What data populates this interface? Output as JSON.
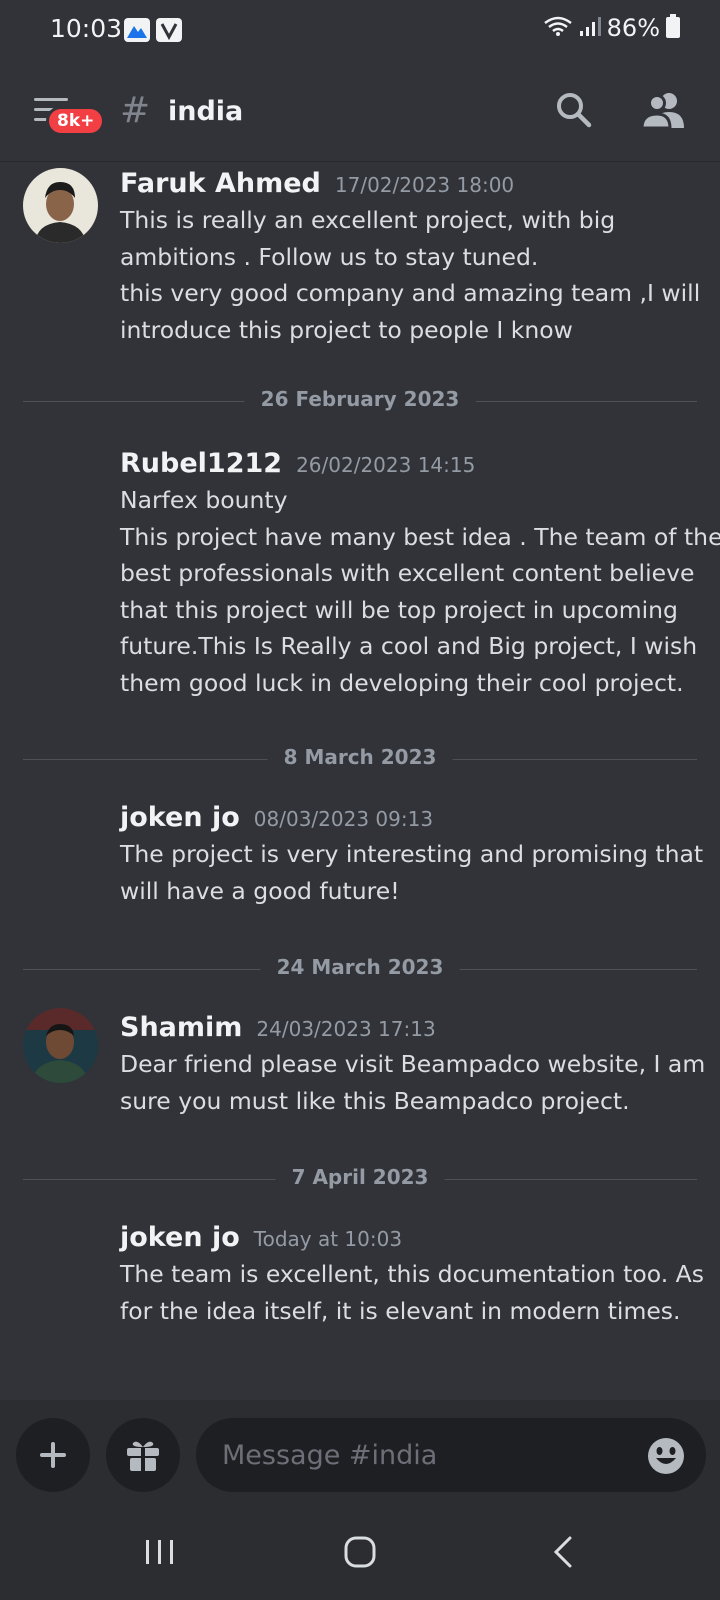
{
  "status_bar": {
    "time": "10:03",
    "battery": "86%",
    "icons": [
      "notification-app-icon",
      "notification-app-icon",
      "wifi-icon",
      "signal-icon",
      "battery-icon"
    ]
  },
  "header": {
    "badge": "8k+",
    "channel": "india",
    "hash": "#"
  },
  "messages": [
    {
      "author": "Faruk Ahmed",
      "timestamp": "17/02/2023 18:00",
      "lines": [
        "This is really an excellent project, with big",
        "ambitions . Follow us to stay tuned.",
        "this very good company and amazing team ,I will",
        "introduce this project to people I know"
      ]
    },
    {
      "author": "Rubel1212",
      "timestamp": "26/02/2023 14:15",
      "lines": [
        "Narfex bounty",
        "This project have many best idea . The team of the",
        "best professionals with excellent content believe",
        "that this project will be top project in upcoming",
        "future.This Is Really a cool and Big project, I wish",
        "them good luck in developing their cool project."
      ]
    },
    {
      "author": "joken  jo",
      "timestamp": "08/03/2023 09:13",
      "lines": [
        "The project is very interesting and promising that",
        "will have a good future!"
      ]
    },
    {
      "author": "Shamim",
      "timestamp": "24/03/2023 17:13",
      "lines": [
        "Dear friend please visit Beampadco  website, I am",
        "sure you must like this Beampadco  project."
      ]
    },
    {
      "author": "joken  jo",
      "timestamp": "Today at 10:03",
      "lines": [
        "The team is excellent, this documentation too. As",
        "for the idea itself, it is elevant in modern times."
      ]
    }
  ],
  "dividers": [
    "26 February 2023",
    "8 March 2023",
    "24 March 2023",
    "7 April 2023"
  ],
  "composer": {
    "placeholder": "Message #india"
  },
  "colors": {
    "background": "#313338",
    "badge": "#f23f43",
    "input_bg": "#1e1f22"
  }
}
